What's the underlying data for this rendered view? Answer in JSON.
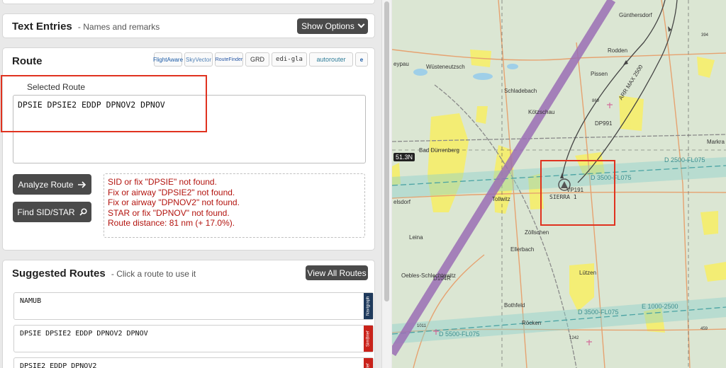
{
  "text_entries": {
    "title": "Text Entries",
    "subtitle": "- Names and remarks",
    "show_options_label": "Show Options"
  },
  "route": {
    "title": "Route",
    "providers": [
      "FlightAware",
      "SkyVector",
      "RouteFinder",
      "GRD",
      "edi-gla",
      "autorouter",
      "e"
    ],
    "selected_label": "Selected Route",
    "selected_value": "DPSIE DPSIE2 EDDP DPNOV2 DPNOV",
    "analyze_label": "Analyze Route",
    "find_sid_label": "Find SID/STAR",
    "messages": [
      "SID or fix \"DPSIE\" not found.",
      "Fix or airway \"DPSIE2\" not found.",
      "Fix or airway \"DPNOV2\" not found.",
      "STAR or fix \"DPNOV\" not found.",
      "Route distance: 81 nm (+ 17.0%)."
    ]
  },
  "suggested": {
    "title": "Suggested Routes",
    "subtitle": "- Click a route to use it",
    "view_all_label": "View All Routes",
    "items": [
      {
        "route": "NAMUB",
        "tag": "Navigraph"
      },
      {
        "route": "DPSIE DPSIE2 EDDP DPNOV2 DPNOV",
        "tag": "SimBrief"
      },
      {
        "route": "DPSIE2 EDDP DPNOV2",
        "tag": "SimBrief"
      }
    ]
  },
  "map": {
    "lat_label": "51.3N",
    "places": {
      "guntersdorf": "Günthersdorf",
      "rodden": "Rodden",
      "wusteneutzsch": "Wüsteneutzsch",
      "eypau": "eypau",
      "pissen": "Pissen",
      "schladebach": "Schladebach",
      "kotzschau": "Kötzschau",
      "bad_durrenberg": "Bad Dürrenberg",
      "markranstadt": "Markra",
      "tollwitz": "Tollwitz",
      "zollschen": "Zöllschen",
      "leina": "Leina",
      "elsdorf": "elsdorf",
      "ellerbach": "Ellerbach",
      "oebles": "Oebles-Schlechtewitz",
      "lutzen": "Lützen",
      "bothfeld": "Bothfeld",
      "rocken": "Röcken"
    },
    "waypoints": {
      "dp991": "DP991",
      "vp191": "VP191",
      "sierra": "SIERRA 1",
      "d104r": "D104R",
      "arr_max": "ARR MAX 2500"
    },
    "airspace": {
      "d2500": "D 2500-FL075",
      "d3500_top": "D 3500-FL075",
      "d3500_bottom": "D 3500-FL075",
      "e1000": "E 1000-2500",
      "d5500": "D 5500-FL075"
    },
    "spot_heights": {
      "h394": "394",
      "h869": "869",
      "h1011": "1011",
      "h1242": "1242",
      "h459": "459"
    }
  },
  "colors": {
    "accent_dark": "#4a4a4a",
    "error_red": "#b3140f",
    "highlight_red": "#e0321f",
    "corridor_purple": "#9b6fb5",
    "airspace_teal": "#5fb3b3"
  }
}
